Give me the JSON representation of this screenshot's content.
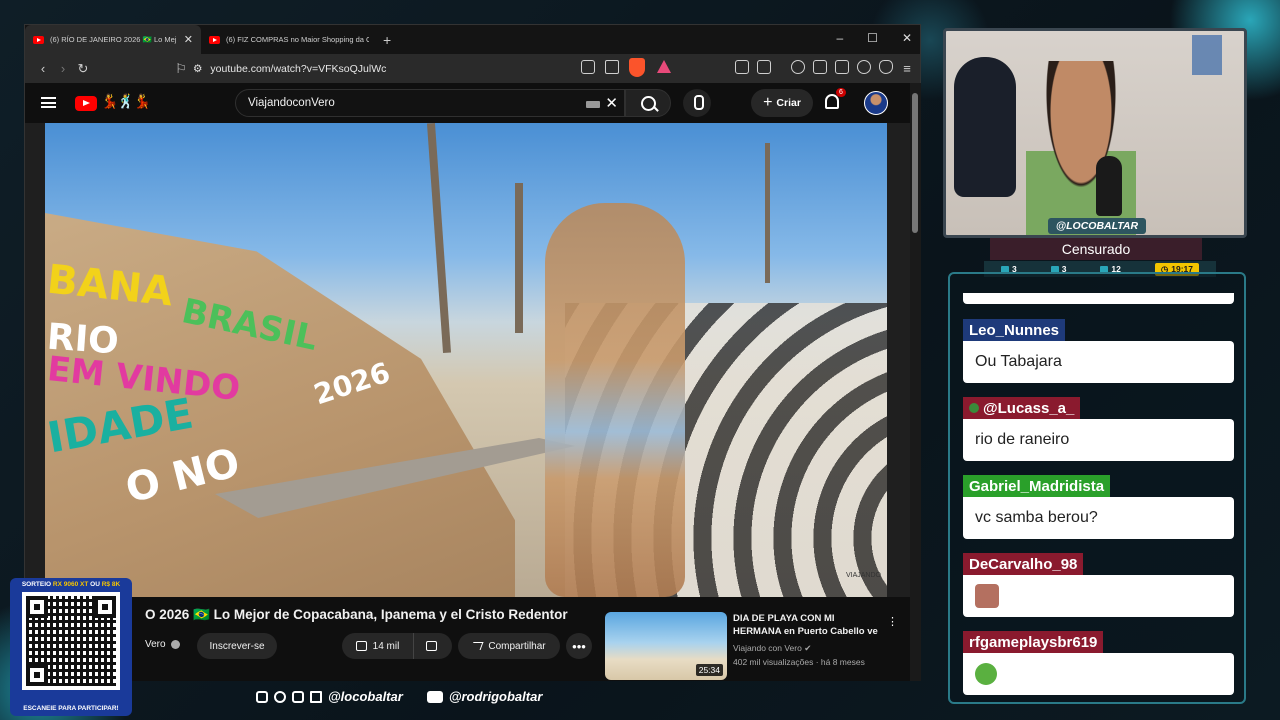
{
  "browser": {
    "tabs": [
      {
        "title": "(6) RÍO DE JANEIRO 2026 🇧🇷 Lo Mej",
        "active": true
      },
      {
        "title": "(6) FIZ COMPRAS no Maior Shopping da Chi",
        "active": false
      }
    ],
    "new_tab": "+",
    "window_controls": [
      "–",
      "☐",
      "✕"
    ],
    "url": "youtube.com/watch?v=VFKsoQJulWc"
  },
  "youtube": {
    "doodle": "💃🕺💃",
    "search_value": "ViajandoconVero",
    "create_label": "Criar",
    "notification_count": "6"
  },
  "video": {
    "sand_lines": [
      "BANA",
      "RIO",
      "BRASIL",
      "EM VINDO",
      "IDADE",
      "2026",
      "O NO"
    ],
    "watermark": "VIAJANDO"
  },
  "video_meta": {
    "title": "O 2026 🇧🇷 Lo Mejor de Copacabana, Ipanema y el Cristo Redentor",
    "channel": "Vero",
    "subscribe_label": "Inscrever-se",
    "likes": "14 mil",
    "share_label": "Compartilhar",
    "more": "•••"
  },
  "recommended": {
    "title": "DIA DE PLAYA CON MI HERMANA en Puerto Cabello ve",
    "channel": "Viajando con Vero",
    "views": "402 mil visualizações",
    "age": "há 8 meses",
    "duration": "25:34"
  },
  "stream": {
    "handle": "@LOCOBALTAR",
    "status": "Censurado",
    "stats": [
      {
        "icon": "chat-icon",
        "value": "3"
      },
      {
        "icon": "video-icon",
        "value": "3"
      },
      {
        "icon": "kick-icon",
        "value": "12"
      }
    ],
    "time": "19:17"
  },
  "chat": {
    "messages": [
      {
        "user": "Leo_Nunnes",
        "text": "Ou Tabajara",
        "color": "#1e3a7a"
      },
      {
        "user": "@Lucass_a_",
        "text": "rio de raneiro",
        "color": "#8a1a2e",
        "badge": true
      },
      {
        "user": "Gabriel_Madridista",
        "text": "vc samba berou?",
        "color": "#2aa02a"
      },
      {
        "user": "DeCarvalho_98",
        "text": "",
        "color": "#8a1a2e",
        "emote": "avatar-emote"
      },
      {
        "user": "rfgameplaysbr619",
        "text": "",
        "color": "#8a1a2e",
        "emote": "green-emote"
      }
    ]
  },
  "giveaway": {
    "header_prefix": "SORTEIO",
    "header_item": "RX 9060 XT",
    "header_or": "OU",
    "header_cash": "R$ 8K",
    "footer": "ESCANEIE PARA PARTICIPAR!"
  },
  "socials": {
    "handle_1": "@locobaltar",
    "handle_2": "@rodrigobaltar"
  },
  "colors": {
    "accent_teal": "#2aa6b8",
    "youtube_red": "#ff0000",
    "time_yellow": "#f2c500"
  }
}
